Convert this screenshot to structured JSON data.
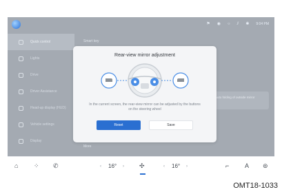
{
  "status": {
    "time": "9:04 PM"
  },
  "sidebar": {
    "items": [
      {
        "label": "Quick control",
        "active": true
      },
      {
        "label": "Lights"
      },
      {
        "label": "Drive"
      },
      {
        "label": "Driver Assistance"
      },
      {
        "label": "Head-up display (HUD)"
      },
      {
        "label": "Vehicle settings"
      },
      {
        "label": "Display"
      }
    ]
  },
  "main": {
    "title": "Smart key",
    "card_text": "Auto folding of outside mirror",
    "more_label": "More"
  },
  "dialog": {
    "title": "Rear-view mirror adjustment",
    "body": "In the current screen, the rear-view mirror can be adjusted by the buttons on the steering wheel",
    "reset_label": "Reset",
    "save_label": "Save"
  },
  "dock": {
    "left_temp": "16°",
    "right_temp": "16°",
    "icons": [
      "home-icon",
      "apps-icon",
      "phone-icon",
      "fan-icon",
      "seat-icon",
      "navigation-icon",
      "settings-icon"
    ]
  },
  "caption": "OMT18-1033",
  "colors": {
    "accent": "#2a6fd1",
    "screen_dim": "#a4aab2"
  }
}
